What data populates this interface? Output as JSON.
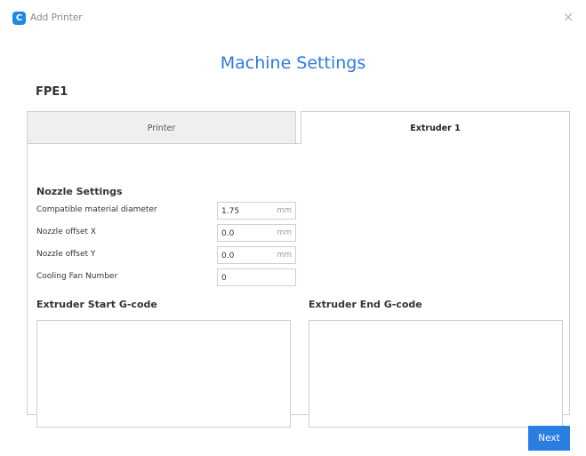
{
  "window": {
    "app_icon_letter": "C",
    "title": "Add Printer",
    "close_symbol": "×"
  },
  "heading": "Machine Settings",
  "printer_name": "FPE1",
  "tabs": [
    {
      "label": "Printer",
      "active": false
    },
    {
      "label": "Extruder 1",
      "active": true
    }
  ],
  "nozzle": {
    "section_title": "Nozzle Settings",
    "rows": [
      {
        "label": "Compatible material diameter",
        "value": "1.75",
        "unit": "mm"
      },
      {
        "label": "Nozzle offset X",
        "value": "0.0",
        "unit": "mm"
      },
      {
        "label": "Nozzle offset Y",
        "value": "0.0",
        "unit": "mm"
      },
      {
        "label": "Cooling Fan Number",
        "value": "0",
        "unit": ""
      }
    ]
  },
  "gcode": {
    "start_title": "Extruder Start G-code",
    "start_value": "",
    "end_title": "Extruder End G-code",
    "end_value": ""
  },
  "footer": {
    "next_label": "Next"
  },
  "colors": {
    "accent": "#2c7be0",
    "button": "#2a7de1",
    "border": "#cfcfcf",
    "inactive_tab": "#efefef"
  }
}
